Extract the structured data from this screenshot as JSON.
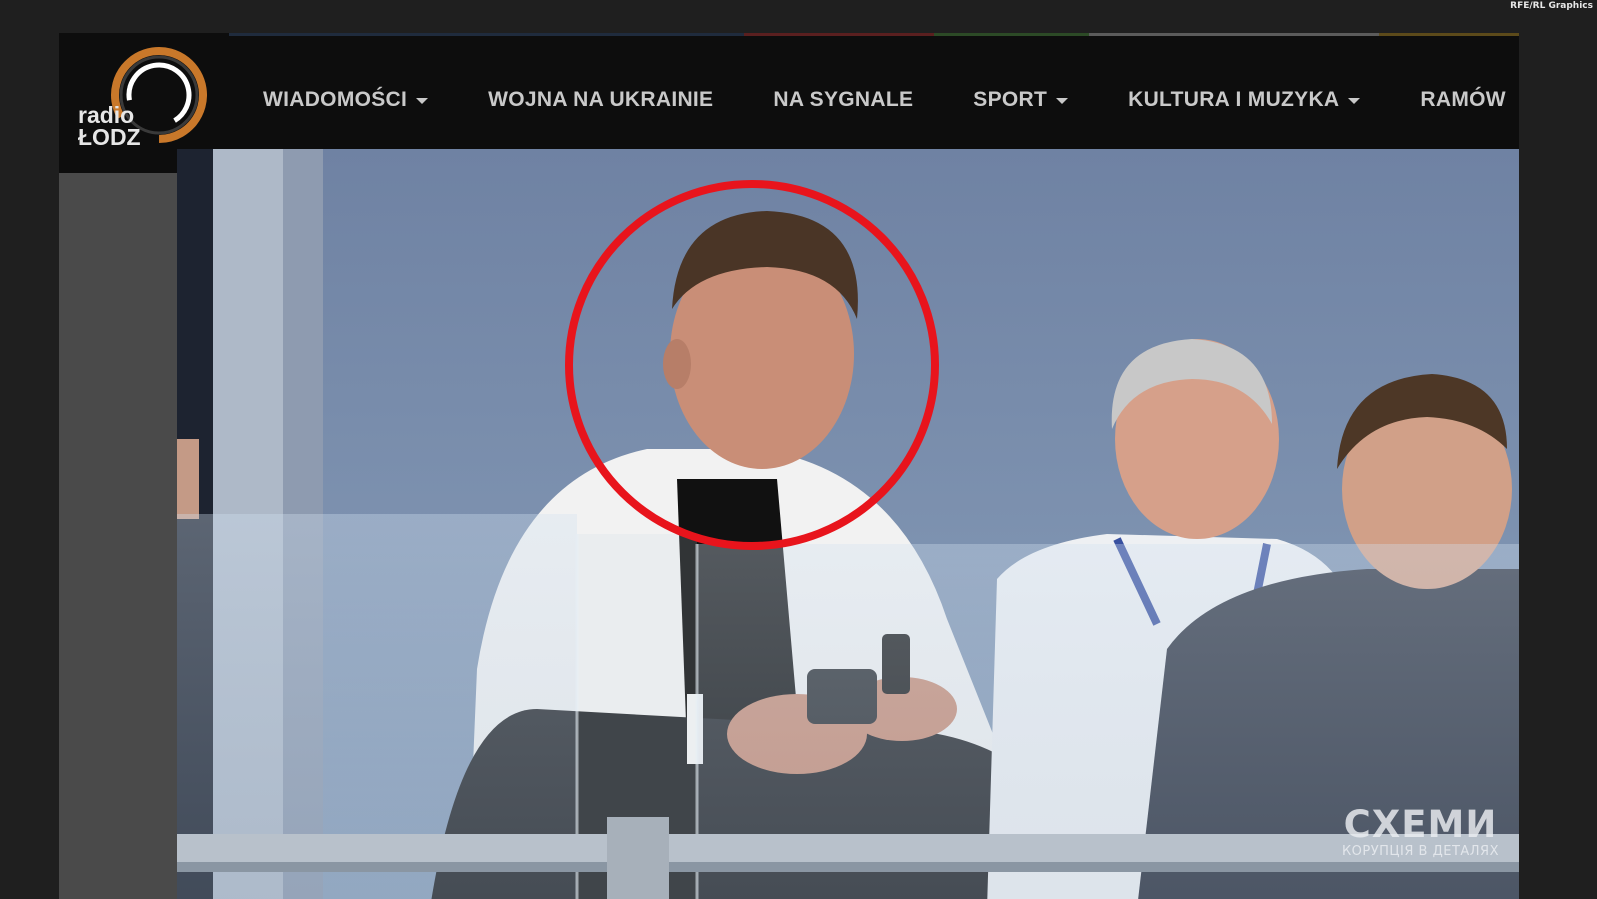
{
  "credit": "RFE/RL Graphics",
  "logo": {
    "line1": "radio",
    "line2": "ŁODZ"
  },
  "nav": {
    "items": [
      {
        "label": "WIADOMOŚCI",
        "dropdown": true
      },
      {
        "label": "WOJNA NA UKRAINIE",
        "dropdown": false
      },
      {
        "label": "NA SYGNALE",
        "dropdown": false
      },
      {
        "label": "SPORT",
        "dropdown": true
      },
      {
        "label": "KULTURA I MUZYKA",
        "dropdown": true
      },
      {
        "label": "RAMÓW",
        "dropdown": false
      }
    ]
  },
  "watermark": {
    "title": "СХЕМИ",
    "subtitle": "КОРУПЦІЯ В ДЕТАЛЯХ"
  },
  "colors": {
    "page_bg": "#1f1f1f",
    "navbar_bg": "#0d0d0d",
    "nav_text": "#c9c9c9",
    "logo_orange": "#c9782a",
    "highlight_circle": "#e8141c",
    "sky": "#7d8fa6"
  }
}
